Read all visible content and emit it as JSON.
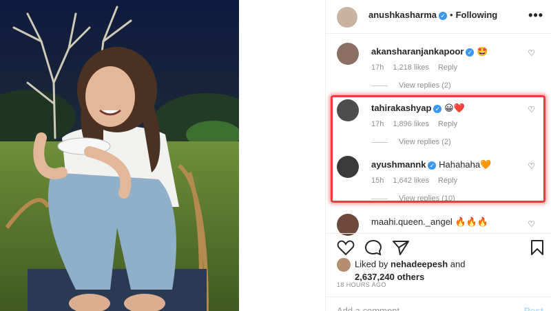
{
  "header": {
    "username": "anushkasharma",
    "separator": "•",
    "follow_status": "Following",
    "more": "•••"
  },
  "comments": [
    {
      "username": "akansharanjankapoor",
      "verified": true,
      "text": "🤩",
      "time": "17h",
      "likes": "1,218 likes",
      "reply": "Reply",
      "view_replies": "View replies (2)"
    },
    {
      "username": "tahirakashyap",
      "verified": true,
      "text": "😀❤️",
      "time": "17h",
      "likes": "1,896 likes",
      "reply": "Reply",
      "view_replies": "View replies (2)"
    },
    {
      "username": "ayushmannk",
      "verified": true,
      "text": "Hahahaha🧡",
      "time": "15h",
      "likes": "1,642 likes",
      "reply": "Reply",
      "view_replies": "View replies (10)"
    },
    {
      "username": "maahi.queen._angel",
      "verified": false,
      "text": "🔥🔥🔥"
    }
  ],
  "likes": {
    "liked_by_prefix": "Liked by",
    "liked_by_user": "nehadeepesh",
    "and": "and",
    "others_count": "2,637,240 others"
  },
  "timestamp": "18 HOURS AGO",
  "add_comment": {
    "placeholder": "Add a comment...",
    "post": "Post"
  },
  "colors": {
    "verified": "#3897f0",
    "highlight": "#ef3b3b"
  }
}
